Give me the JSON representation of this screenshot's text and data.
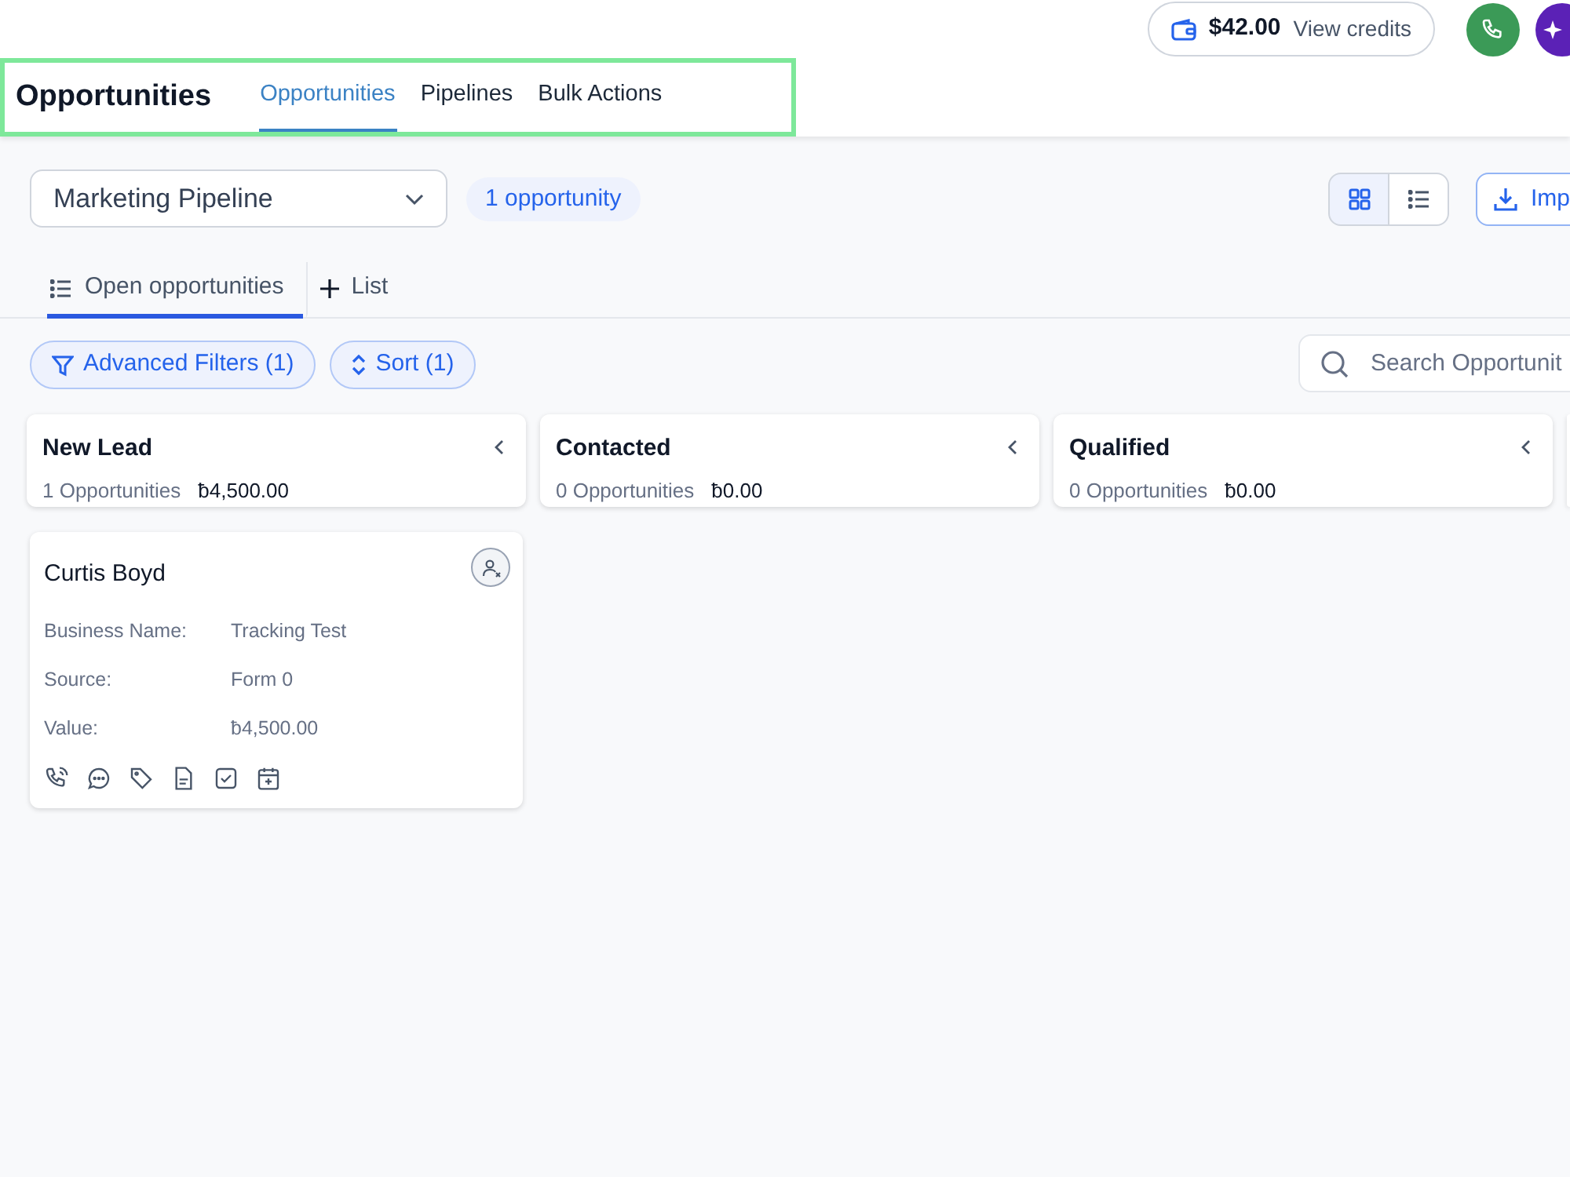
{
  "header": {
    "title": "Opportunities",
    "tabs": [
      {
        "label": "Opportunities",
        "selected": true
      },
      {
        "label": "Pipelines",
        "selected": false
      },
      {
        "label": "Bulk Actions",
        "selected": false
      }
    ],
    "credits": {
      "amount": "$42.00",
      "label": "View credits"
    }
  },
  "toolbar": {
    "pipeline": "Marketing Pipeline",
    "count": "1 opportunity",
    "views": [
      {
        "kind": "grid",
        "selected": true
      },
      {
        "kind": "list",
        "selected": false
      }
    ],
    "import": "Imp"
  },
  "list_tabs": [
    {
      "label": "Open opportunities",
      "selected": true
    },
    {
      "label": "List",
      "selected": false
    }
  ],
  "filters": [
    {
      "kind": "filter",
      "label": "Advanced Filters (1)"
    },
    {
      "kind": "sort",
      "label": "Sort (1)"
    }
  ],
  "search": {
    "placeholder": "Search Opportunit"
  },
  "stages": [
    {
      "name": "New Lead",
      "count": "1 Opportunities",
      "total": "ƀ4,500.00",
      "cards": [
        {
          "name": "Curtis Boyd",
          "fields": [
            {
              "label": "Business Name:",
              "value": "Tracking Test"
            },
            {
              "label": "Source:",
              "value": "Form 0"
            },
            {
              "label": "Value:",
              "value": "ƀ4,500.00"
            }
          ]
        }
      ]
    },
    {
      "name": "Contacted",
      "count": "0 Opportunities",
      "total": "ƀ0.00"
    },
    {
      "name": "Qualified",
      "count": "0 Opportunities",
      "total": "ƀ0.00"
    }
  ]
}
